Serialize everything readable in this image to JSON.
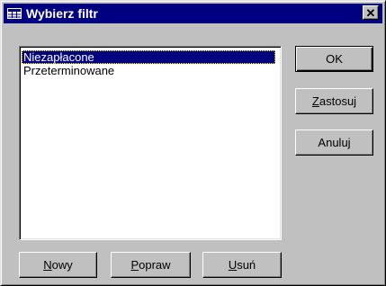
{
  "window": {
    "title": "Wybierz filtr",
    "title_icon": "table-icon",
    "close_icon": "close-icon"
  },
  "filters": {
    "items": [
      "Niezapłacone",
      "Przeterminowane"
    ],
    "selected_index": 0
  },
  "buttons": {
    "ok": "OK",
    "apply": {
      "mnemonic": "Z",
      "rest": "astosuj"
    },
    "cancel": "Anuluj",
    "new": {
      "mnemonic": "N",
      "rest": "owy"
    },
    "edit": {
      "mnemonic": "P",
      "rest": "opraw"
    },
    "delete": {
      "mnemonic": "U",
      "rest": "suń"
    }
  },
  "colors": {
    "title_bar": "#000080",
    "face": "#c0c0c0",
    "selection": "#000080"
  }
}
